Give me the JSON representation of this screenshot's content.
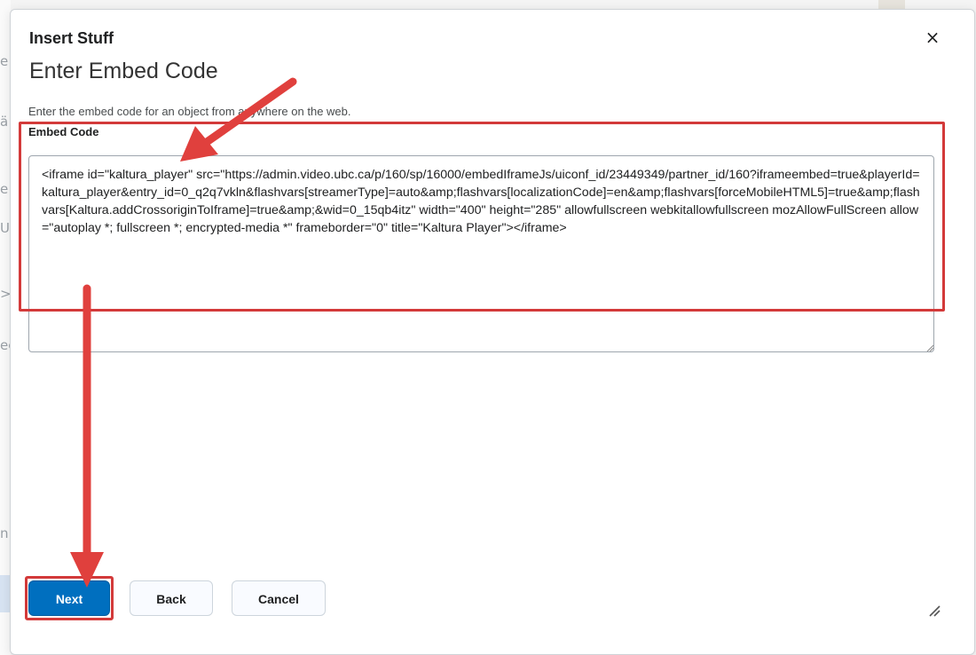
{
  "background": {
    "left_fragments": [
      "e",
      "ä",
      "e",
      "U",
      ">",
      "ee",
      "n"
    ]
  },
  "dialog": {
    "title": "Insert Stuff",
    "close_glyph": "×",
    "heading": "Enter Embed Code",
    "instructions": "Enter the embed code for an object from anywhere on the web.",
    "field_label": "Embed Code",
    "embed_code_value": "<iframe id=\"kaltura_player\" src=\"https://admin.video.ubc.ca/p/160/sp/16000/embedIframeJs/uiconf_id/23449349/partner_id/160?iframeembed=true&playerId=kaltura_player&entry_id=0_q2q7vkln&flashvars[streamerType]=auto&amp;flashvars[localizationCode]=en&amp;flashvars[forceMobileHTML5]=true&amp;flashvars[Kaltura.addCrossoriginToIframe]=true&amp;&wid=0_15qb4itz\" width=\"400\" height=\"285\" allowfullscreen webkitallowfullscreen mozAllowFullScreen allow=\"autoplay *; fullscreen *; encrypted-media *\" frameborder=\"0\" title=\"Kaltura Player\"></iframe>"
  },
  "buttons": {
    "next": "Next",
    "back": "Back",
    "cancel": "Cancel"
  },
  "colors": {
    "primary_button": "#006fbf",
    "annotation_red": "#d33a3a",
    "annotation_arrow": "#e0403d"
  },
  "icons": {
    "close": "close-icon",
    "textarea_resize": "resize-grip-icon",
    "dialog_resize": "resize-grip-icon"
  }
}
